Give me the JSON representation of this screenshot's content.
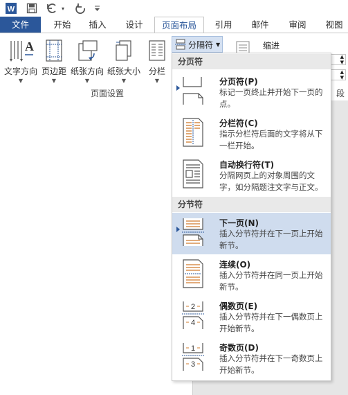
{
  "qat": {
    "word_logo": "W",
    "save_icon": "save-icon",
    "undo_icon": "undo-icon",
    "redo_icon": "redo-icon",
    "customize_icon": "customize-icon"
  },
  "tabs": [
    {
      "label": "文件"
    },
    {
      "label": "开始"
    },
    {
      "label": "插入"
    },
    {
      "label": "设计"
    },
    {
      "label": "页面布局"
    },
    {
      "label": "引用"
    },
    {
      "label": "邮件"
    },
    {
      "label": "审阅"
    },
    {
      "label": "视图"
    }
  ],
  "ribbon": {
    "buttons": [
      {
        "label": "文字方向"
      },
      {
        "label": "页边距"
      },
      {
        "label": "纸张方向"
      },
      {
        "label": "纸张大小"
      },
      {
        "label": "分栏"
      }
    ],
    "breaks_label": "分隔符",
    "indent_label": "缩进",
    "paragraph_fragment": "段",
    "group_label": "页面设置"
  },
  "menu": {
    "page_breaks_header": "分页符",
    "section_breaks_header": "分节符",
    "items": [
      {
        "title": "分页符(P)",
        "desc": "标记一页终止并开始下一页的点。"
      },
      {
        "title": "分栏符(C)",
        "desc": "指示分栏符后面的文字将从下一栏开始。"
      },
      {
        "title": "自动换行符(T)",
        "desc": "分隔网页上的对象周围的文字，如分隔题注文字与正文。"
      },
      {
        "title": "下一页(N)",
        "desc": "插入分节符并在下一页上开始新节。"
      },
      {
        "title": "连续(O)",
        "desc": "插入分节符并在同一页上开始新节。"
      },
      {
        "title": "偶数页(E)",
        "desc": "插入分节符并在下一偶数页上开始新节。"
      },
      {
        "title": "奇数页(D)",
        "desc": "插入分节符并在下一奇数页上开始新节。"
      }
    ],
    "highlighted_item": "下一页(N)",
    "even_icon_number": "2",
    "even_icon_number2": "4",
    "odd_icon_number": "1",
    "odd_icon_number2": "3"
  },
  "colors": {
    "word_blue": "#2b579a",
    "highlight": "#cfdcee",
    "section_header_bg": "#e9e9e9",
    "icon_orange": "#d07b2d"
  }
}
